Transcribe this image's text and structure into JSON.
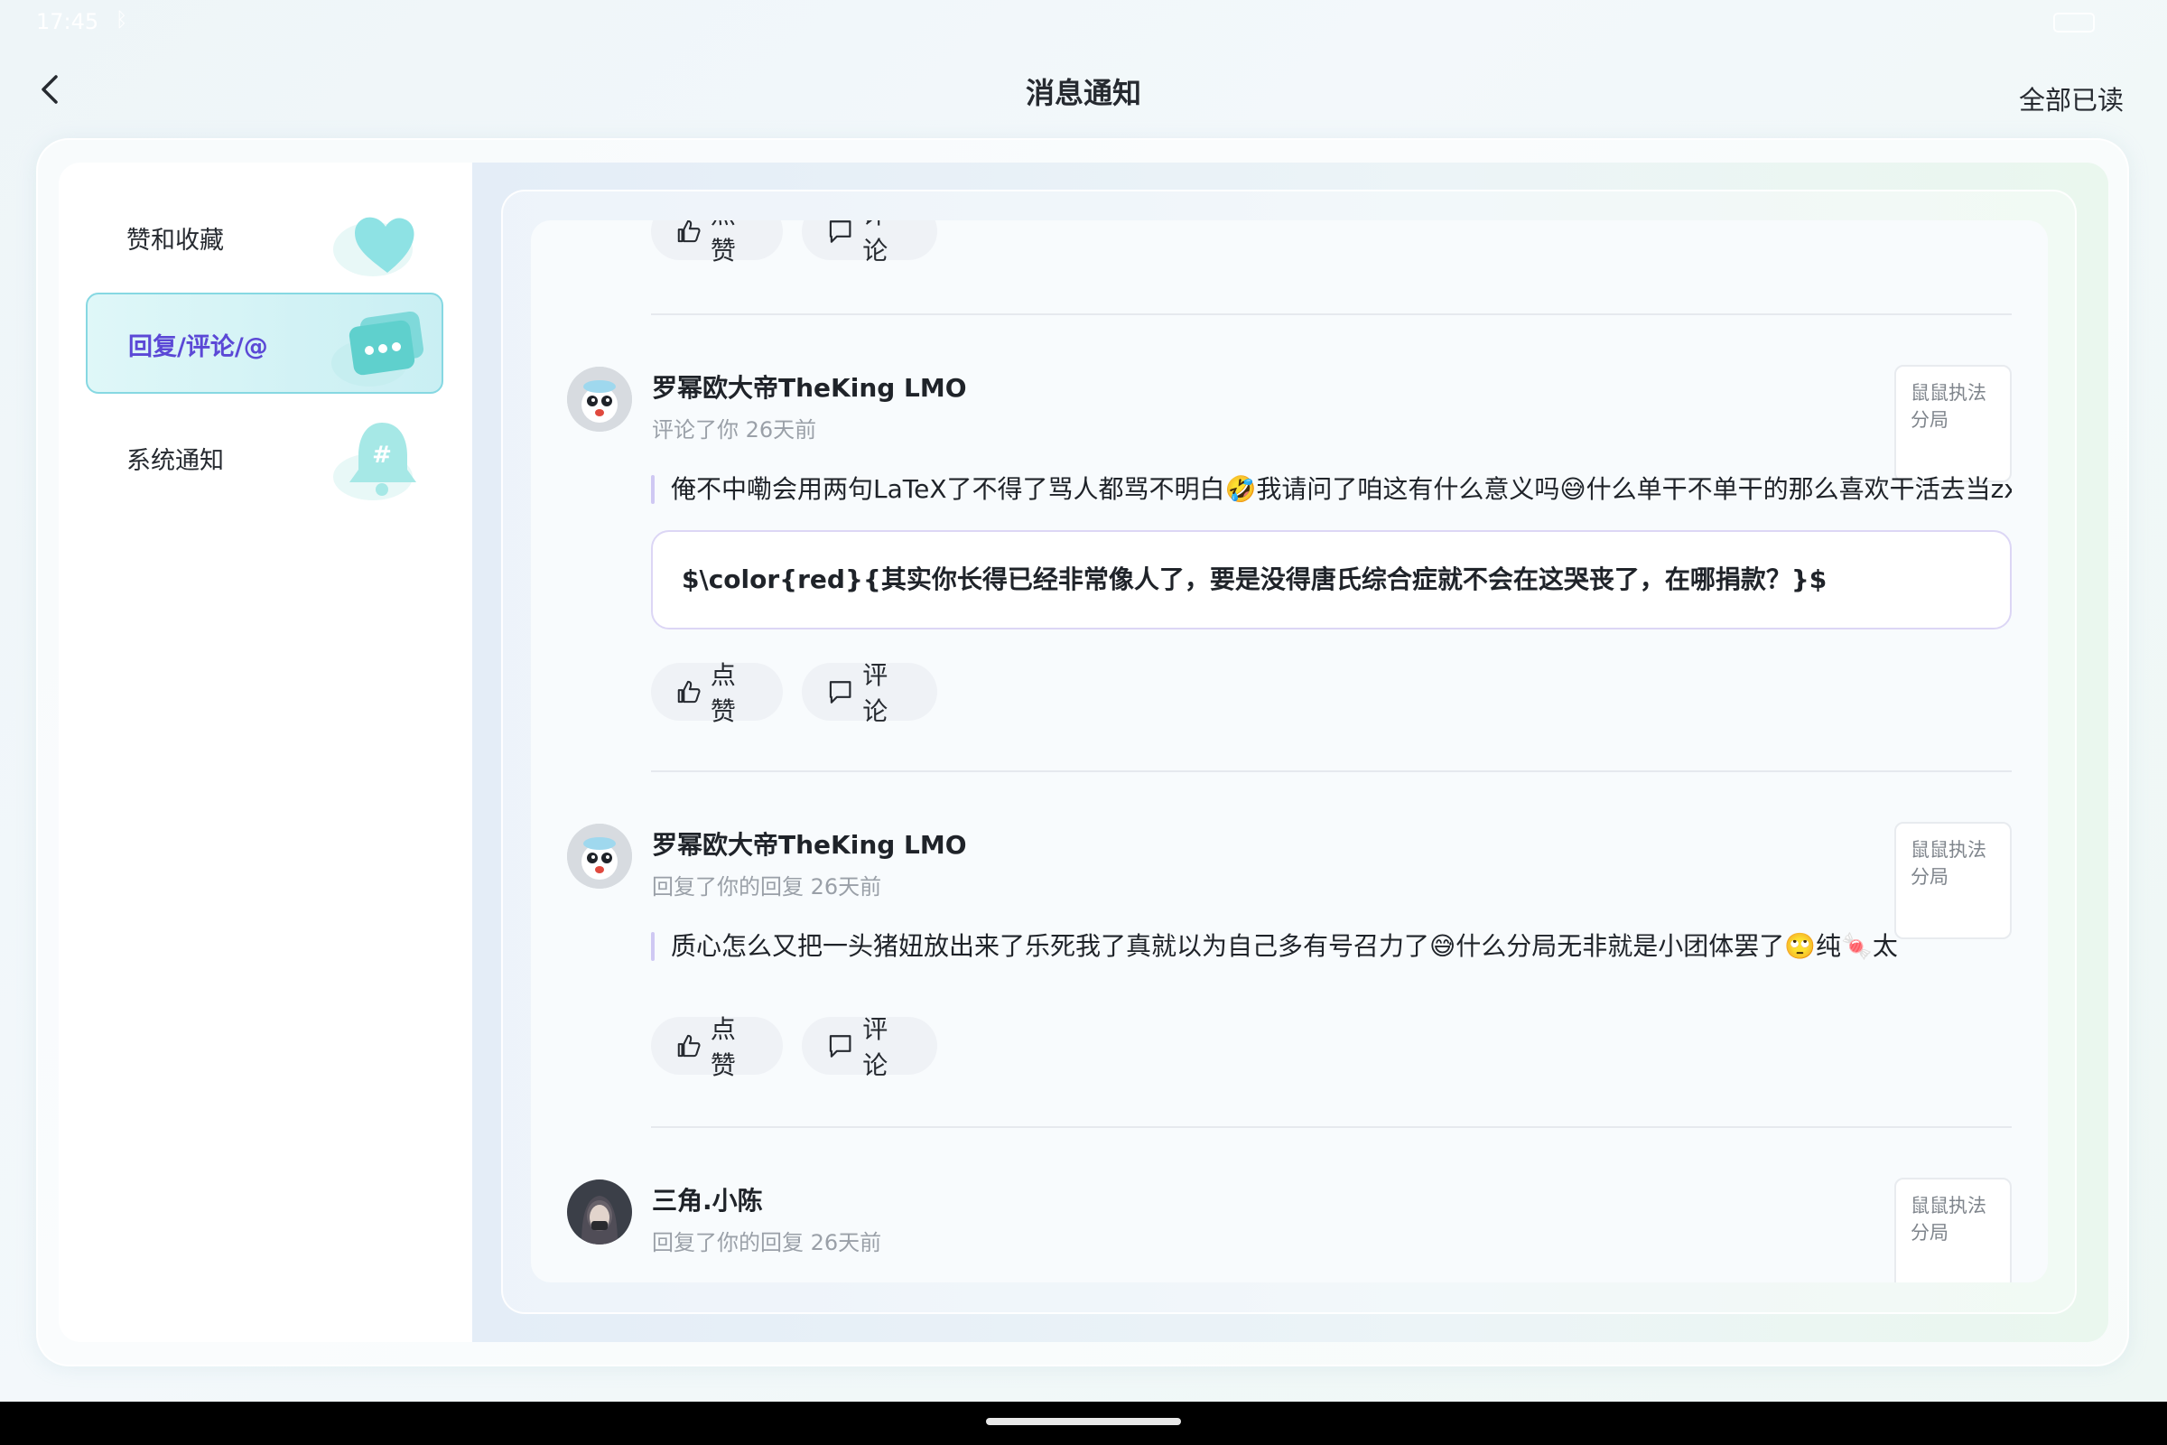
{
  "status_bar": {
    "time": "17:45",
    "bluetooth_icon": "bluetooth-icon",
    "battery_icon": "battery-icon"
  },
  "header": {
    "title": "消息通知",
    "mark_all_read": "全部已读",
    "back_icon": "chevron-left-icon"
  },
  "sidebar": {
    "items": [
      {
        "label": "赞和收藏",
        "icon": "heart-icon",
        "active": false
      },
      {
        "label": "回复/评论/@",
        "icon": "chat-bubble-icon",
        "active": true
      },
      {
        "label": "系统通知",
        "icon": "bell-icon",
        "active": false
      }
    ]
  },
  "actions": {
    "like_label": "点赞",
    "comment_label": "评论"
  },
  "notifications": [
    {
      "user": "罗幂欧大帝TheKing LMO",
      "meta": "评论了你 26天前",
      "quote": "俺不中嘞会用两句LaTeX了不得了骂人都骂不明白🤣我请问了咱这有什么意义吗😅什么单干不单干的那么喜欢干活去当zx",
      "reply": "$\\color{red}{其实你长得已经非常像人了，要是没得唐氏综合症就不会在这哭丧了，在哪捐款？}$",
      "thumb": "鼠鼠执法分局"
    },
    {
      "user": "罗幂欧大帝TheKing LMO",
      "meta": "回复了你的回复 26天前",
      "quote": "质心怎么又把一头猪妞放出来了乐死我了真就以为自己多有号召力了😅什么分局无非就是小团体罢了🙄纯🍬太纯了",
      "thumb": "鼠鼠执法分局"
    },
    {
      "user": "三角.小陈",
      "meta": "回复了你的回复 26天前",
      "thumb": "鼠鼠执法分局"
    }
  ],
  "colors": {
    "accent": "#5b48d6",
    "active_bg": "#d4f3f6",
    "teal": "#5fd6d0"
  }
}
